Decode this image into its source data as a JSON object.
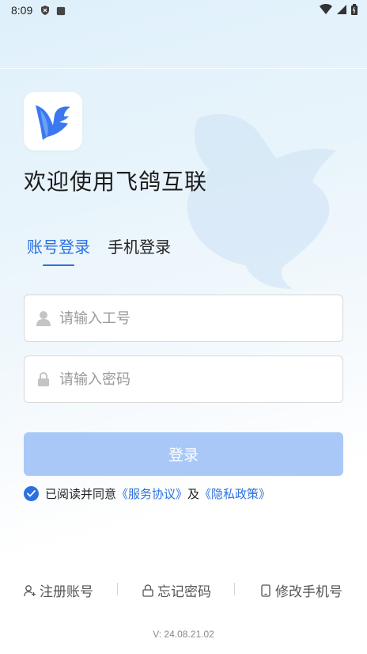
{
  "status_bar": {
    "time": "8:09"
  },
  "welcome_title": "欢迎使用飞鸽互联",
  "tabs": [
    {
      "label": "账号登录",
      "active": true
    },
    {
      "label": "手机登录",
      "active": false
    }
  ],
  "fields": {
    "employee_id": {
      "placeholder": "请输入工号",
      "value": "",
      "icon": "user-icon"
    },
    "password": {
      "placeholder": "请输入密码",
      "value": "",
      "icon": "lock-icon"
    }
  },
  "login_button": {
    "label": "登录",
    "enabled": false
  },
  "agreement": {
    "checked": true,
    "prefix": "已阅读并同意",
    "service_link": "《服务协议》",
    "joiner": "及",
    "privacy_link": "《隐私政策》"
  },
  "footer": {
    "register": {
      "label": "注册账号",
      "icon": "add-user-icon"
    },
    "forgot_password": {
      "label": "忘记密码",
      "icon": "lock-icon"
    },
    "change_phone": {
      "label": "修改手机号",
      "icon": "phone-icon"
    }
  },
  "version": "V: 24.08.21.02",
  "colors": {
    "accent": "#2a70e0",
    "button_disabled": "#a9c8f8",
    "logo_blue": "#3b78f0"
  }
}
